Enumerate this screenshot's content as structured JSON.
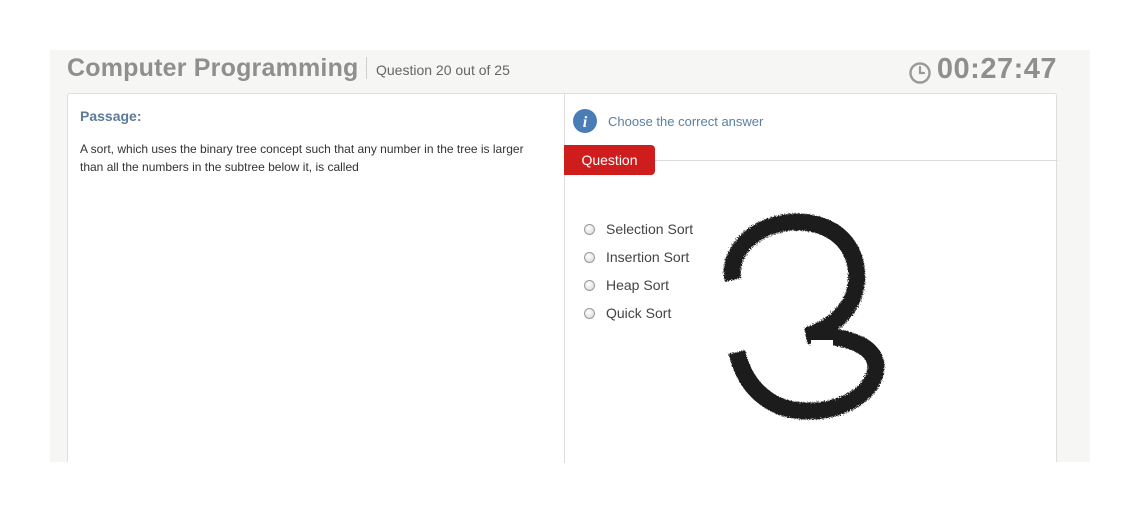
{
  "header": {
    "title": "Computer Programming",
    "question_counter": "Question 20 out of 25",
    "timer": "00:27:47"
  },
  "passage": {
    "label": "Passage:",
    "text": "A sort, which uses the binary tree concept such that any number in the tree is larger than all the numbers in the subtree below it, is called"
  },
  "question": {
    "instruction": "Choose the correct answer",
    "tab_label": "Question",
    "options": [
      "Selection Sort",
      "Insertion Sort",
      "Heap Sort",
      "Quick Sort"
    ]
  },
  "colors": {
    "accent_red": "#cf1d1d",
    "label_blue": "#5d7a98",
    "info_blue": "#4a7db5"
  },
  "overlay_glyph": "3"
}
